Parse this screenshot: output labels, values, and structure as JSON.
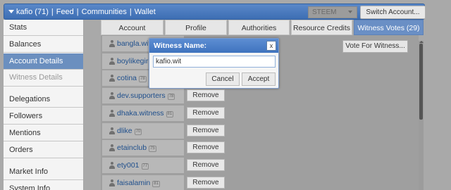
{
  "topbar": {
    "account": "kafio (71)",
    "nav": [
      "Feed",
      "Communities",
      "Wallet"
    ],
    "chain": "STEEM",
    "switch_label": "Switch Account..."
  },
  "sidebar": {
    "items": [
      {
        "label": "Stats",
        "state": "normal"
      },
      {
        "label": "Balances",
        "state": "normal"
      },
      {
        "label": "Account Details",
        "state": "active"
      },
      {
        "label": "Witness Details",
        "state": "disabled"
      },
      {
        "label": "Delegations",
        "state": "normal"
      },
      {
        "label": "Followers",
        "state": "normal"
      },
      {
        "label": "Mentions",
        "state": "normal"
      },
      {
        "label": "Orders",
        "state": "normal"
      },
      {
        "label": "Market Info",
        "state": "normal"
      },
      {
        "label": "System Info",
        "state": "normal"
      }
    ]
  },
  "tabs": [
    "Account",
    "Profile",
    "Authorities",
    "Resource Credits",
    "Witness Votes (29)"
  ],
  "active_tab": "Witness Votes (29)",
  "vote_button": "Vote For Witness...",
  "remove_label": "Remove",
  "witnesses": [
    {
      "name": "bangla.witness",
      "rep": "",
      "show_remove": false
    },
    {
      "name": "boylikegirl.wit",
      "rep": "",
      "show_remove": false
    },
    {
      "name": "cotina",
      "rep": "78",
      "show_remove": false
    },
    {
      "name": "dev.supporters",
      "rep": "78",
      "show_remove": true
    },
    {
      "name": "dhaka.witness",
      "rep": "81",
      "show_remove": true
    },
    {
      "name": "dlike",
      "rep": "70",
      "show_remove": true
    },
    {
      "name": "etainclub",
      "rep": "75",
      "show_remove": true
    },
    {
      "name": "ety001",
      "rep": "77",
      "show_remove": true
    },
    {
      "name": "faisalamin",
      "rep": "81",
      "show_remove": true
    }
  ],
  "dialog": {
    "title": "Witness Name:",
    "close": "x",
    "value": "kafio.wit",
    "cancel": "Cancel",
    "accept": "Accept"
  },
  "colors": {
    "accent": "#4a7ac2",
    "active_sidebar": "#6b8fbf",
    "link": "#1f4f8c"
  }
}
